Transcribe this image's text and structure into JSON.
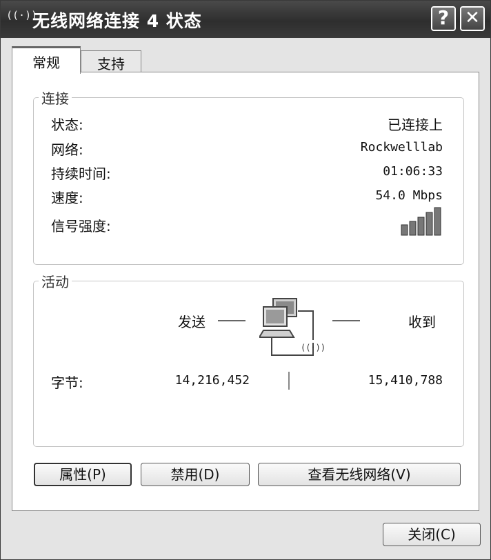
{
  "window": {
    "title": "无线网络连接 4 状态"
  },
  "titlebar": {
    "icon_glyph": "((·))",
    "help_glyph": "?",
    "close_glyph": "✕"
  },
  "tabs": [
    {
      "label": "常规",
      "active": true
    },
    {
      "label": "支持",
      "active": false
    }
  ],
  "connection": {
    "group_label": "连接",
    "rows": [
      {
        "label": "状态:",
        "value": "已连接上"
      },
      {
        "label": "网络:",
        "value": "Rockwelllab"
      },
      {
        "label": "持续时间:",
        "value": "01:06:33"
      },
      {
        "label": "速度:",
        "value": "54.0 Mbps"
      },
      {
        "label": "信号强度:",
        "signal_bars": 5,
        "signal_bars_filled": 5
      }
    ]
  },
  "activity": {
    "group_label": "活动",
    "sent_label": "发送",
    "received_label": "收到",
    "bytes_label": "字节:",
    "bytes_sent": "14,216,452",
    "bytes_received": "15,410,788",
    "wifi_glyph": "((·))"
  },
  "buttons": {
    "properties": "属性(P)",
    "disable": "禁用(D)",
    "view_wireless": "查看无线网络(V)",
    "close": "关闭(C)"
  }
}
